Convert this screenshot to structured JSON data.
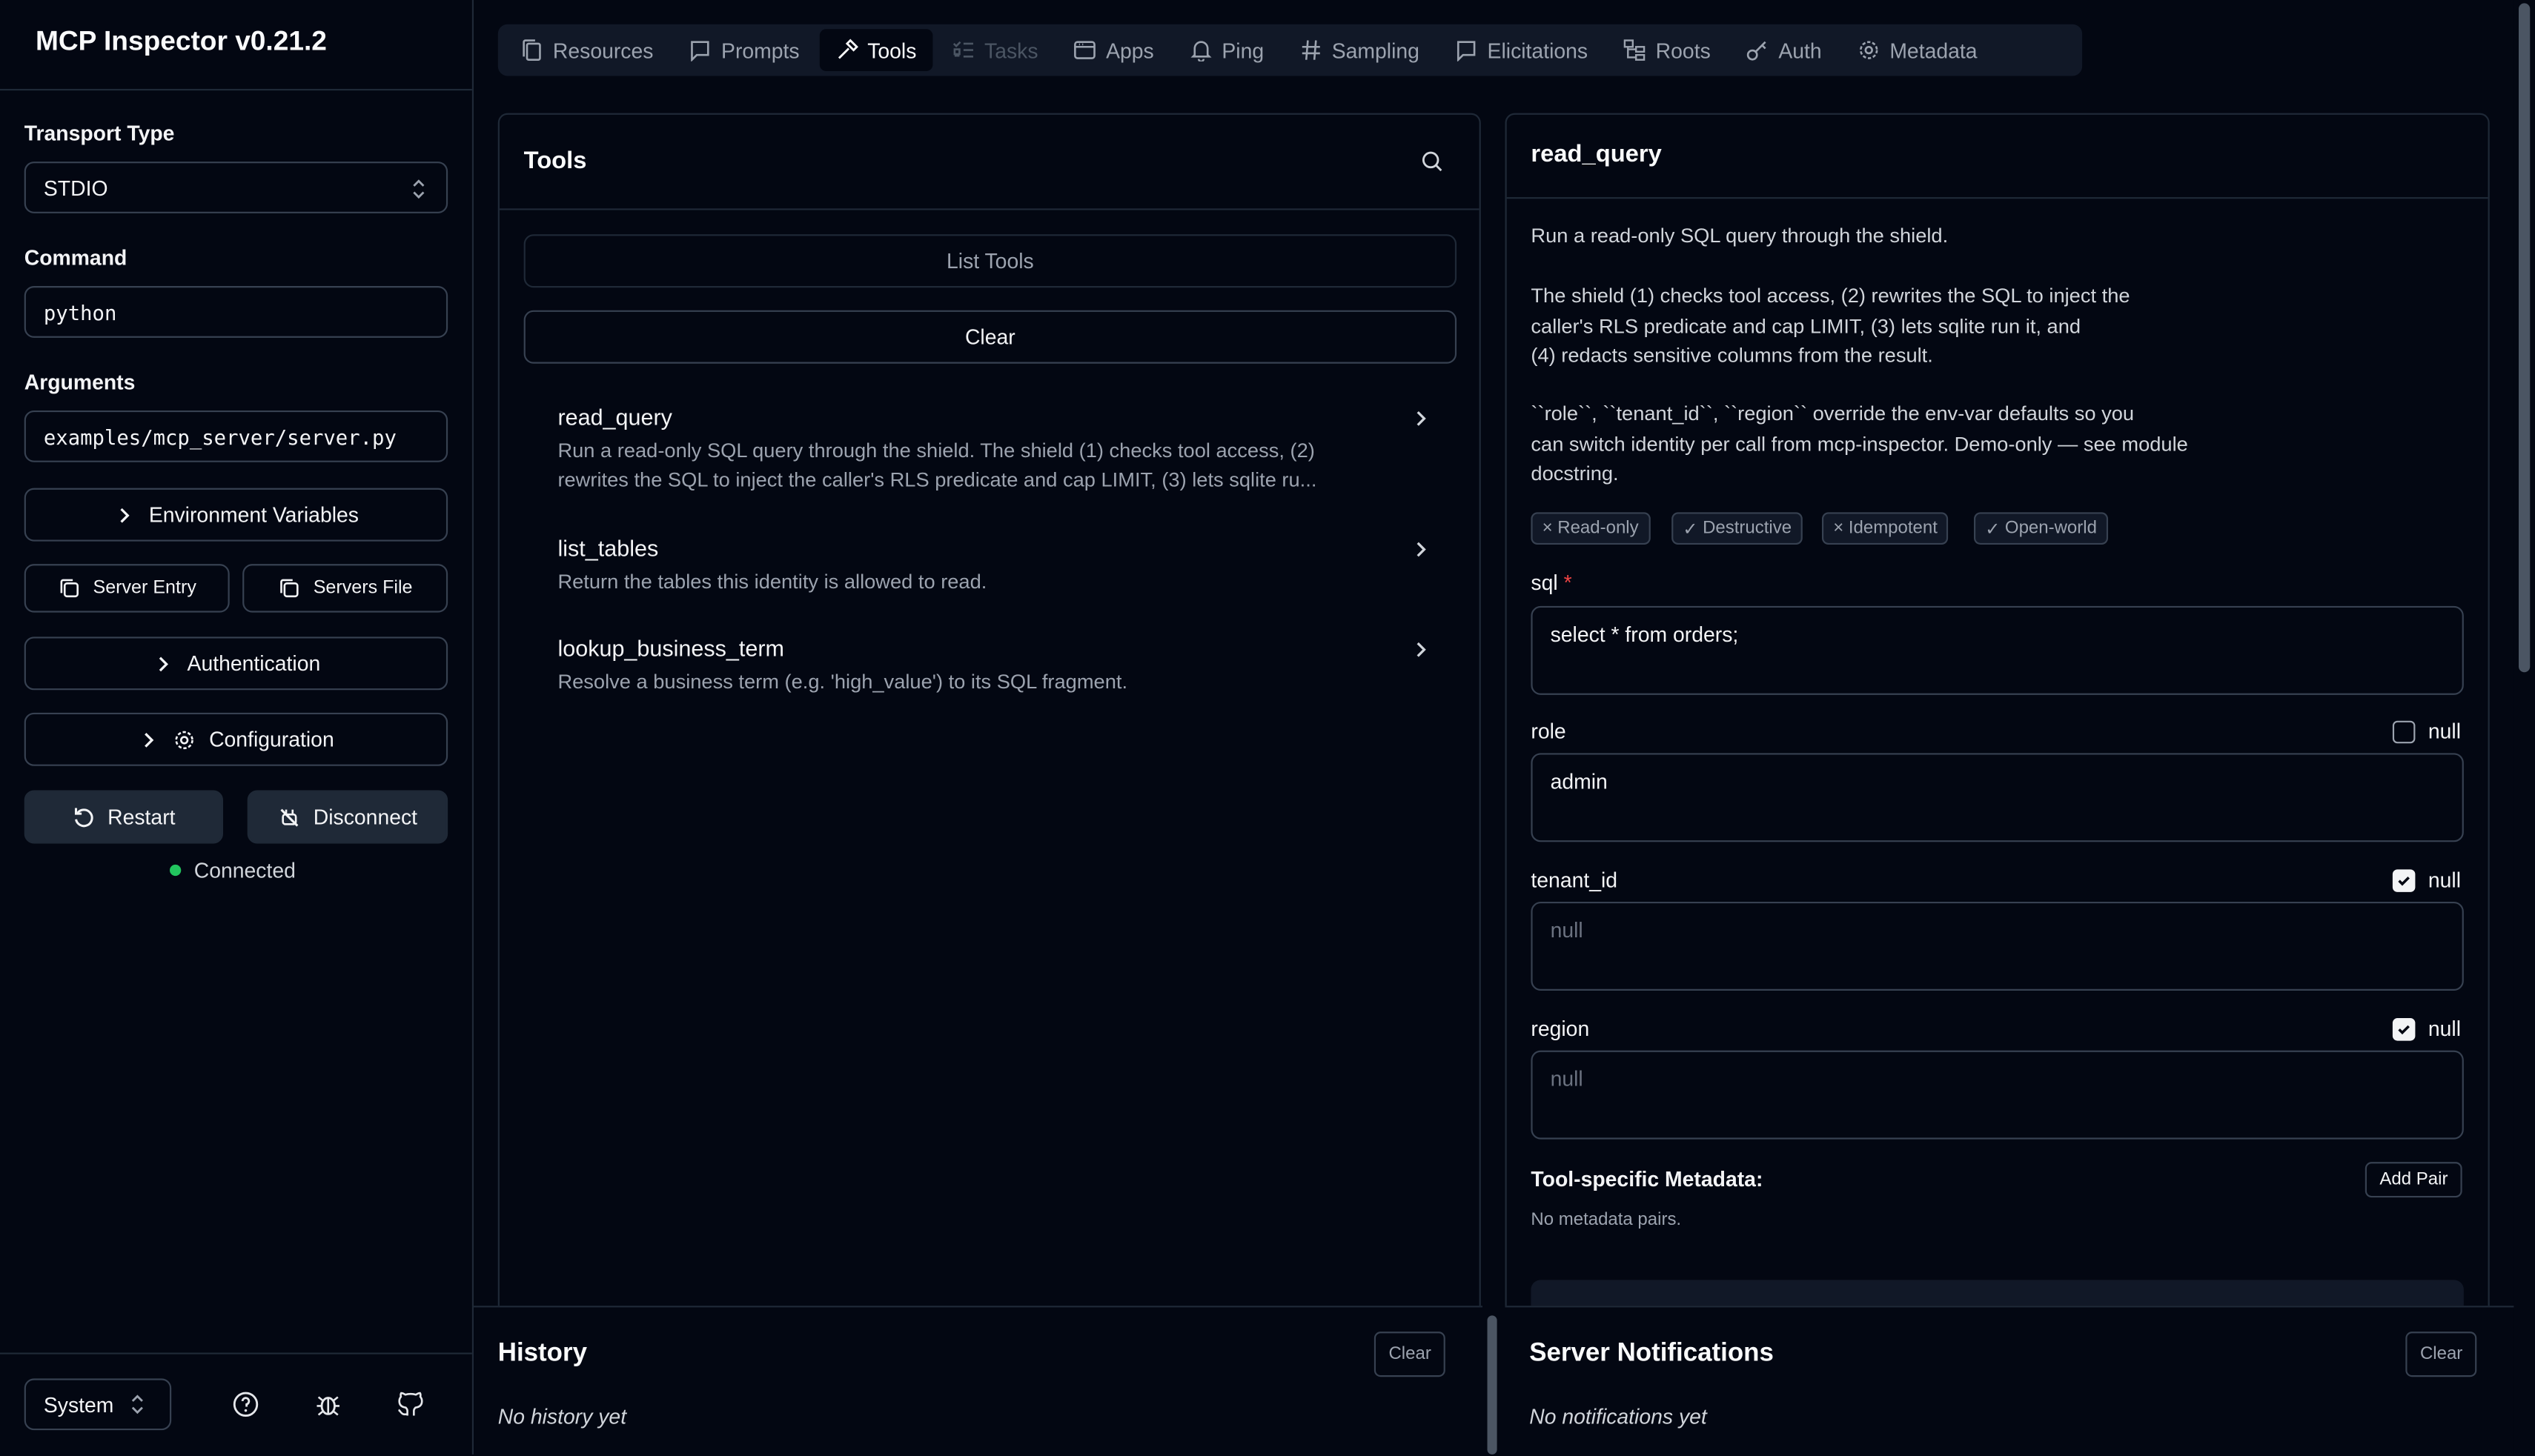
{
  "app": {
    "title": "MCP Inspector v0.21.2"
  },
  "sidebar": {
    "transport_label": "Transport Type",
    "transport_value": "STDIO",
    "command_label": "Command",
    "command_value": "python",
    "arguments_label": "Arguments",
    "arguments_value": "examples/mcp_server/server.py",
    "env_vars_label": "Environment Variables",
    "server_entry_label": "Server Entry",
    "servers_file_label": "Servers File",
    "authentication_label": "Authentication",
    "configuration_label": "Configuration",
    "restart_label": "Restart",
    "disconnect_label": "Disconnect",
    "status_text": "Connected",
    "status_color": "#22c55e",
    "theme_value": "System"
  },
  "tabs": [
    {
      "label": "Resources",
      "icon": "files-icon"
    },
    {
      "label": "Prompts",
      "icon": "message-icon"
    },
    {
      "label": "Tools",
      "icon": "hammer-icon",
      "active": true
    },
    {
      "label": "Tasks",
      "icon": "list-todo-icon",
      "disabled": true
    },
    {
      "label": "Apps",
      "icon": "app-window-icon"
    },
    {
      "label": "Ping",
      "icon": "bell-icon"
    },
    {
      "label": "Sampling",
      "icon": "hash-icon"
    },
    {
      "label": "Elicitations",
      "icon": "message-square-icon"
    },
    {
      "label": "Roots",
      "icon": "folder-tree-icon"
    },
    {
      "label": "Auth",
      "icon": "key-icon"
    },
    {
      "label": "Metadata",
      "icon": "gear-icon"
    }
  ],
  "tools_panel": {
    "title": "Tools",
    "list_button": "List Tools",
    "clear_button": "Clear",
    "items": [
      {
        "name": "read_query",
        "desc1": "Run a read-only SQL query through the shield. The shield (1) checks tool access, (2)",
        "desc2": "rewrites the SQL to inject the caller's RLS predicate and cap LIMIT, (3) lets sqlite ru..."
      },
      {
        "name": "list_tables",
        "desc1": "Return the tables this identity is allowed to read."
      },
      {
        "name": "lookup_business_term",
        "desc1": "Resolve a business term (e.g. 'high_value') to its SQL fragment."
      }
    ]
  },
  "detail": {
    "title": "read_query",
    "desc_p1": "Run a read-only SQL query through the shield.",
    "desc_p2": "The shield (1) checks tool access, (2) rewrites the SQL to inject the\ncaller's RLS predicate and cap LIMIT, (3) lets sqlite run it, and\n(4) redacts sensitive columns from the result.",
    "desc_p3": "``role``, ``tenant_id``, ``region`` override the env-var defaults so you\ncan switch identity per call from mcp-inspector. Demo-only — see module\ndocstring.",
    "badges": [
      {
        "mark": "×",
        "label": "Read-only"
      },
      {
        "mark": "✓",
        "label": "Destructive"
      },
      {
        "mark": "×",
        "label": "Idempotent"
      },
      {
        "mark": "✓",
        "label": "Open-world"
      }
    ],
    "sql_label": "sql",
    "required_mark": "*",
    "sql_value": "select * from orders;",
    "role_label": "role",
    "role_value": "admin",
    "tenant_label": "tenant_id",
    "tenant_placeholder": "null",
    "region_label": "region",
    "region_placeholder": "null",
    "null_label": "null",
    "metadata_title": "Tool-specific Metadata:",
    "add_pair_label": "Add Pair",
    "no_metadata": "No metadata pairs."
  },
  "history": {
    "title": "History",
    "clear": "Clear",
    "empty": "No history yet"
  },
  "notifications": {
    "title": "Server Notifications",
    "clear": "Clear",
    "empty": "No notifications yet"
  }
}
